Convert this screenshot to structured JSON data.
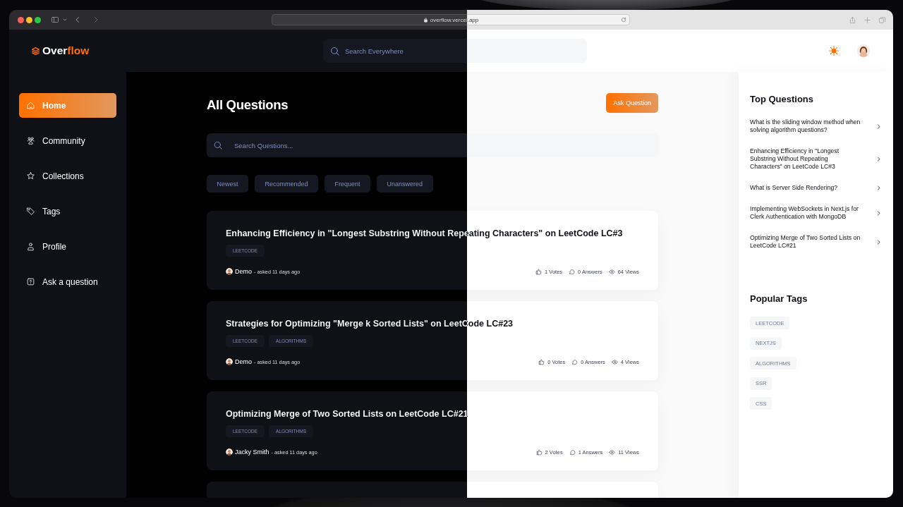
{
  "browser": {
    "url": "overflow.vercel.app"
  },
  "header": {
    "logo_text": "Over",
    "logo_accent": "flow",
    "search": {
      "placeholder": "Search Everywhere"
    }
  },
  "sidebar": {
    "items": [
      {
        "label": "Home",
        "selected": true
      },
      {
        "label": "Community",
        "selected": false
      },
      {
        "label": "Collections",
        "selected": false
      },
      {
        "label": "Tags",
        "selected": false
      },
      {
        "label": "Profile",
        "selected": false
      },
      {
        "label": "Ask a question",
        "selected": false
      }
    ]
  },
  "main": {
    "title": "All Questions",
    "ask_button": "Ask Question",
    "search": {
      "placeholder": "Search Questions..."
    },
    "filters": [
      {
        "label": "Newest",
        "selected": false
      },
      {
        "label": "Recommended",
        "selected": false
      },
      {
        "label": "Frequent",
        "selected": false
      },
      {
        "label": "Unanswered",
        "selected": false
      }
    ],
    "questions": [
      {
        "kind": "full",
        "title": "Enhancing Efficiency in \"Longest Substring Without Repeating Characters\" on LeetCode LC#3",
        "tags": [
          "LEETCODE"
        ],
        "author": "Demo",
        "asked": "- asked 11 days ago",
        "votes": "1 Votes",
        "answers": "0 Answers",
        "views": "64 Views"
      },
      {
        "kind": "full",
        "title": "Strategies for Optimizing \"Merge k Sorted Lists\" on LeetCode LC#23",
        "tags": [
          "LEETCODE",
          "ALGORITHMS"
        ],
        "author": "Demo",
        "asked": "- asked 11 days ago",
        "votes": "0 Votes",
        "answers": "0 Answers",
        "views": "4 Views"
      },
      {
        "kind": "full",
        "title": "Optimizing Merge of Two Sorted Lists on LeetCode LC#21",
        "tags": [
          "LEETCODE",
          "ALGORITHMS"
        ],
        "author": "Jacky Smith",
        "asked": "- asked 11 days ago",
        "votes": "2 Votes",
        "answers": "1 Answers",
        "views": "11 Views"
      },
      {
        "kind": "cut"
      }
    ]
  },
  "right": {
    "top_questions": {
      "title": "Top Questions",
      "items": [
        "What is the sliding window method when solving algorithm questions?",
        "Enhancing Efficiency in \"Longest Substring Without Repeating Characters\" on LeetCode LC#3",
        "What is Server Side Rendering?",
        "Implementing WebSockets in Next.js for Clerk Authentication with MongoDB",
        "Optimizing Merge of Two Sorted Lists on LeetCode LC#21"
      ]
    },
    "popular_tags": {
      "title": "Popular Tags",
      "tags": [
        "LEETCODE",
        "NEXTJS",
        "ALGORITHMS",
        "SSR",
        "CSS"
      ]
    }
  }
}
